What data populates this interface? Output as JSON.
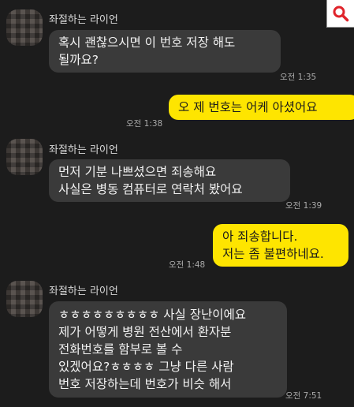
{
  "search_icon": "search-icon",
  "colors": {
    "background": "#1c1c1c",
    "incoming_bubble": "#3a3a3a",
    "outgoing_bubble": "#fee500",
    "search_accent": "#e0242b"
  },
  "messages": [
    {
      "sender": "좌절하는 라이언",
      "lines": [
        "혹시 괜찮으시면 이 번호 저장 해도",
        "될까요?"
      ],
      "time": "오전 1:35"
    },
    {
      "lines": [
        "오 제 번호는 어케 아셨어요"
      ],
      "time": "오전 1:38"
    },
    {
      "sender": "좌절하는 라이언",
      "lines": [
        "먼저 기분 나쁘셨으면 죄송해요",
        "사실은 병동 컴퓨터로 연락처 봤어요"
      ],
      "time": "오전 1:39"
    },
    {
      "lines": [
        "아 죄송합니다.",
        "저는 좀 불편하네요."
      ],
      "time": "오전 1:48"
    },
    {
      "sender": "좌절하는 라이언",
      "lines": [
        "ㅎㅎㅎㅎㅎㅎㅎㅎㅎ 사실 장난이에요",
        "제가 어떻게 병원 전산에서 환자분",
        "전화번호를 함부로 볼 수",
        "있겠어요?ㅎㅎㅎㅎ 그냥 다른 사람",
        "번호 저장하는데 번호가 비슷 해서"
      ],
      "time": "오전 7:51"
    }
  ]
}
